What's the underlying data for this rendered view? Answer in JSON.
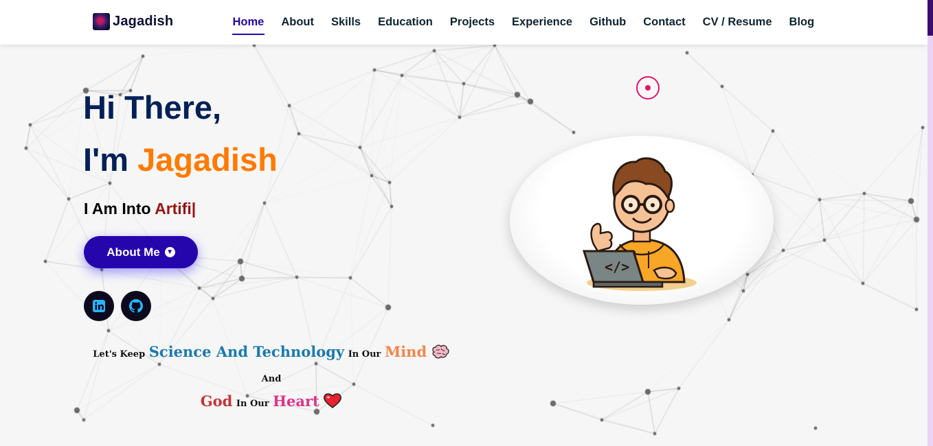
{
  "brand": {
    "name": "Jagadish"
  },
  "nav": {
    "items": [
      {
        "label": "Home",
        "active": true
      },
      {
        "label": "About"
      },
      {
        "label": "Skills"
      },
      {
        "label": "Education"
      },
      {
        "label": "Projects"
      },
      {
        "label": "Experience"
      },
      {
        "label": "Github"
      },
      {
        "label": "Contact"
      },
      {
        "label": "CV / Resume"
      },
      {
        "label": "Blog"
      }
    ]
  },
  "hero": {
    "greeting": "Hi There,",
    "im_prefix": "I'm",
    "name": "Jagadish",
    "into_prefix": "I Am Into",
    "typed_text": "Artifi|",
    "about_button": "About Me",
    "social": [
      {
        "name": "LinkedIn",
        "icon": "linkedin-icon",
        "color": "#26b6ff"
      },
      {
        "name": "GitHub",
        "icon": "github-icon",
        "color": "#26b6ff"
      }
    ]
  },
  "quote": {
    "p1": "Let's Keep",
    "science": "Science And Technology",
    "p2": "In Our",
    "mind": "Mind",
    "mind_icon": "brain-icon",
    "p3": "And",
    "god": "God",
    "p4": "In Our",
    "heart": "Heart",
    "heart_icon": "heart-icon"
  },
  "colors": {
    "accent": "#2506ad",
    "navy": "#002057",
    "orange": "#ff7a00",
    "typed": "#991111",
    "pink": "#e1146c",
    "background": "#f6f6f6"
  }
}
